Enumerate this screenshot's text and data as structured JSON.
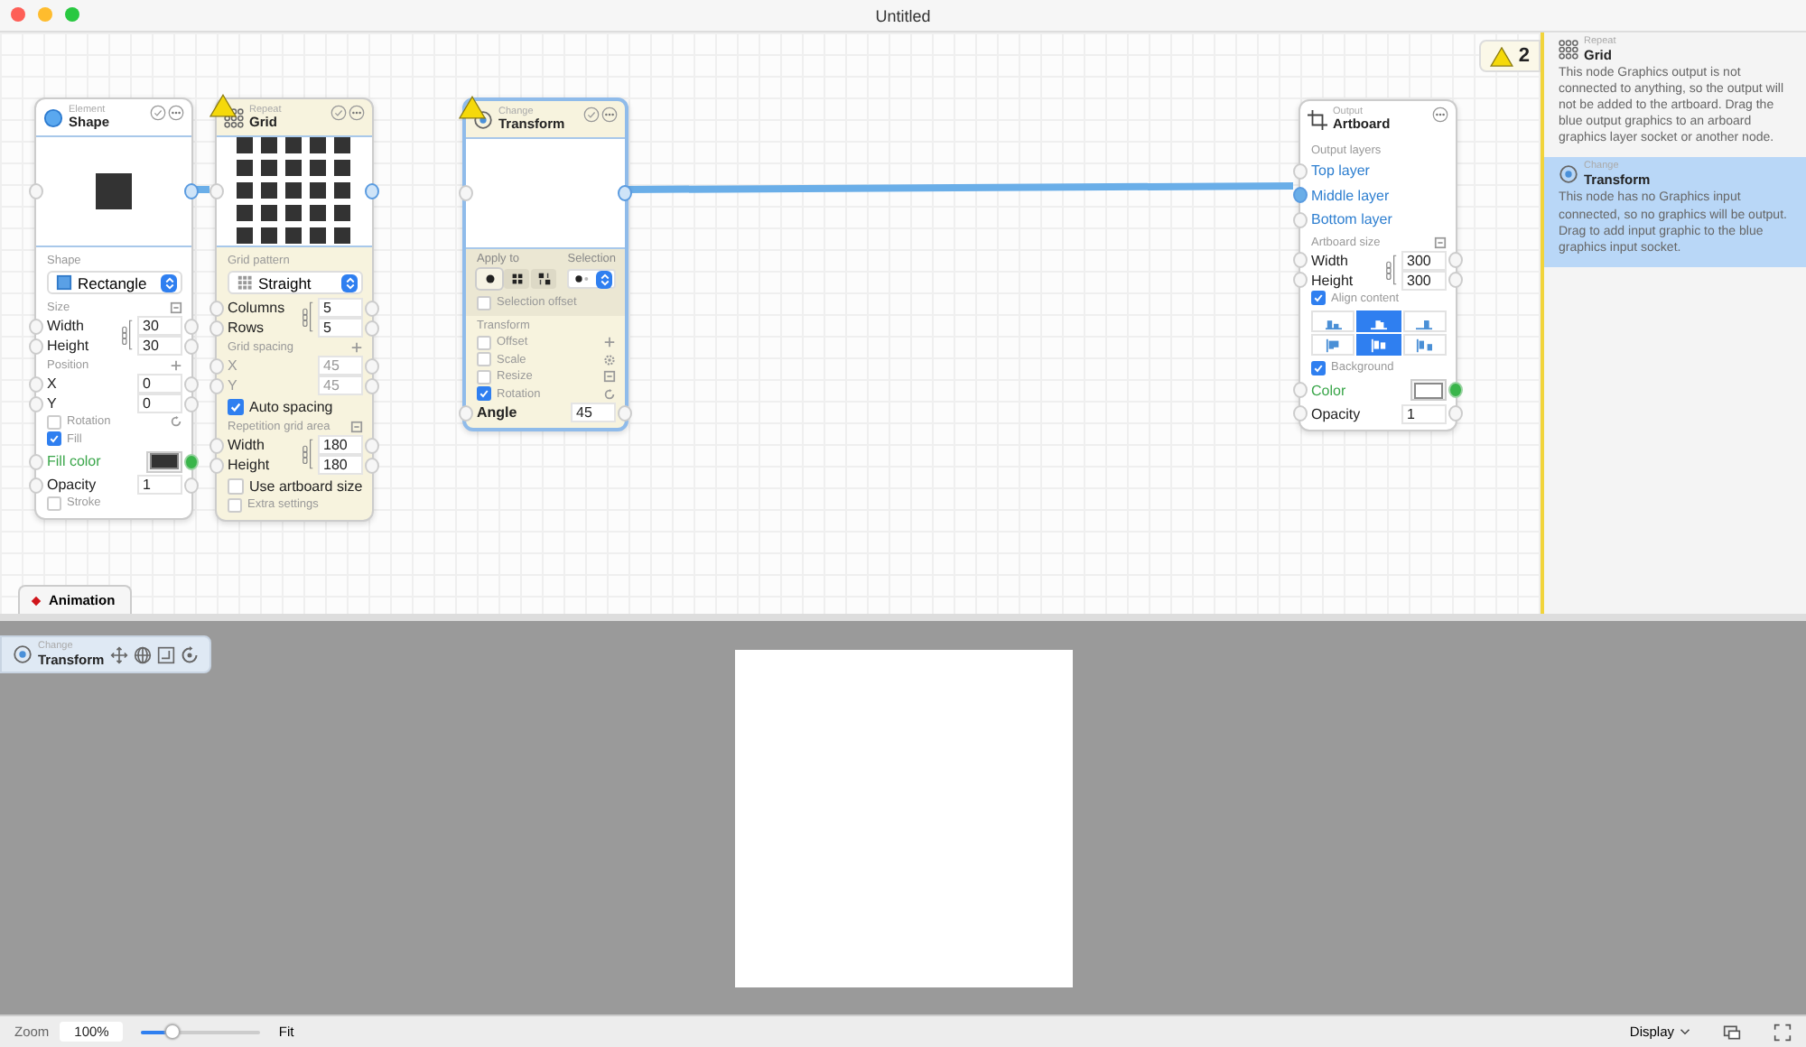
{
  "window": {
    "title": "Untitled"
  },
  "nodes": [
    {
      "kind": "element",
      "category": "Element",
      "title": "Shape",
      "warning": false,
      "selected": false,
      "rows": [
        {
          "kind": "section",
          "label": "Shape"
        },
        {
          "kind": "select",
          "value": "Rectangle"
        },
        {
          "kind": "section",
          "label": "Size"
        },
        {
          "kind": "linked",
          "fields": [
            {
              "label": "Width",
              "value": "30",
              "disabled": false
            },
            {
              "label": "Height",
              "value": "30",
              "disabled": false
            }
          ]
        },
        {
          "kind": "section",
          "label": "Position"
        },
        {
          "kind": "number",
          "label": "X",
          "value": "0",
          "disabled": false
        },
        {
          "kind": "number",
          "label": "Y",
          "value": "0",
          "disabled": false
        },
        {
          "kind": "check",
          "label": "Rotation",
          "checked": false
        },
        {
          "kind": "check",
          "label": "Fill",
          "checked": true
        },
        {
          "kind": "color",
          "label": "Fill color",
          "color": "#333333"
        },
        {
          "kind": "number",
          "label": "Opacity",
          "value": "1",
          "disabled": false
        },
        {
          "kind": "check",
          "label": "Stroke",
          "checked": false
        }
      ]
    },
    {
      "kind": "repeat",
      "category": "Repeat",
      "title": "Grid",
      "warning": true,
      "selected": false,
      "rows": [
        {
          "kind": "section",
          "label": "Grid pattern"
        },
        {
          "kind": "select",
          "value": "Straight"
        },
        {
          "kind": "linked",
          "fields": [
            {
              "label": "Columns",
              "value": "5",
              "disabled": false
            },
            {
              "label": "Rows",
              "value": "5",
              "disabled": false
            }
          ]
        },
        {
          "kind": "section",
          "label": "Grid spacing"
        },
        {
          "kind": "number",
          "label": "X",
          "value": "45",
          "disabled": true
        },
        {
          "kind": "number",
          "label": "Y",
          "value": "45",
          "disabled": true
        },
        {
          "kind": "bigcheck",
          "label": "Auto spacing",
          "checked": true
        },
        {
          "kind": "section",
          "label": "Repetition grid area"
        },
        {
          "kind": "linked",
          "fields": [
            {
              "label": "Width",
              "value": "180",
              "disabled": false
            },
            {
              "label": "Height",
              "value": "180",
              "disabled": false
            }
          ]
        },
        {
          "kind": "bigcheck",
          "label": "Use artboard size",
          "checked": false
        },
        {
          "kind": "check",
          "label": "Extra settings",
          "checked": false
        }
      ]
    },
    {
      "kind": "change",
      "category": "Change",
      "title": "Transform",
      "warning": true,
      "selected": true,
      "rows": [
        {
          "kind": "apply",
          "label": "Apply to",
          "selection_label": "Selection",
          "options": [
            {
              "selected": true
            },
            {
              "selected": false
            },
            {
              "selected": false
            }
          ]
        },
        {
          "kind": "check",
          "label": "Selection offset",
          "checked": false
        },
        {
          "kind": "section",
          "label": "Transform"
        },
        {
          "kind": "check",
          "label": "Offset",
          "checked": false
        },
        {
          "kind": "check",
          "label": "Scale",
          "checked": false
        },
        {
          "kind": "check",
          "label": "Resize",
          "checked": false
        },
        {
          "kind": "check",
          "label": "Rotation",
          "checked": true
        },
        {
          "kind": "number",
          "label": "Angle",
          "value": "45",
          "disabled": false
        }
      ]
    },
    {
      "kind": "output",
      "category": "Output",
      "title": "Artboard",
      "warning": false,
      "selected": false,
      "rows": [
        {
          "kind": "section",
          "label": "Output layers"
        },
        {
          "kind": "layer",
          "label": "Top layer",
          "connected": false
        },
        {
          "kind": "layer",
          "label": "Middle layer",
          "connected": true
        },
        {
          "kind": "layer",
          "label": "Bottom layer",
          "connected": false
        },
        {
          "kind": "section",
          "label": "Artboard size"
        },
        {
          "kind": "linked",
          "fields": [
            {
              "label": "Width",
              "value": "300",
              "disabled": false
            },
            {
              "label": "Height",
              "value": "300",
              "disabled": false
            }
          ]
        },
        {
          "kind": "check",
          "label": "Align content",
          "checked": true
        },
        {
          "kind": "align",
          "options": [
            {
              "selected": false
            },
            {
              "selected": true
            },
            {
              "selected": false
            },
            {
              "selected": false
            },
            {
              "selected": true
            },
            {
              "selected": false
            }
          ]
        },
        {
          "kind": "check",
          "label": "Background",
          "checked": true
        },
        {
          "kind": "color",
          "label": "Color",
          "color": "#ffffff"
        },
        {
          "kind": "number",
          "label": "Opacity",
          "value": "1",
          "disabled": false
        }
      ]
    }
  ],
  "warning_badge": {
    "count": "2"
  },
  "warnings": [
    {
      "category": "Repeat",
      "title": "Grid",
      "text": "This node Graphics output is not connected to anything, so the output will not be added to the artboard. Drag the blue output graphics to an arboard graphics layer socket or another node.",
      "selected": false
    },
    {
      "category": "Change",
      "title": "Transform",
      "text": "This node has no Graphics input connected, so no graphics will be output. Drag to add input graphic to the blue graphics input socket.",
      "selected": true
    }
  ],
  "tabs": [
    {
      "label": "Animation"
    }
  ],
  "preview_toolbar": {
    "category": "Change",
    "title": "Transform"
  },
  "status_bar": {
    "zoom_label": "Zoom",
    "zoom_value": "100%",
    "zoom_slider": {
      "level": 0.25
    },
    "fit": "Fit",
    "display": "Display"
  }
}
